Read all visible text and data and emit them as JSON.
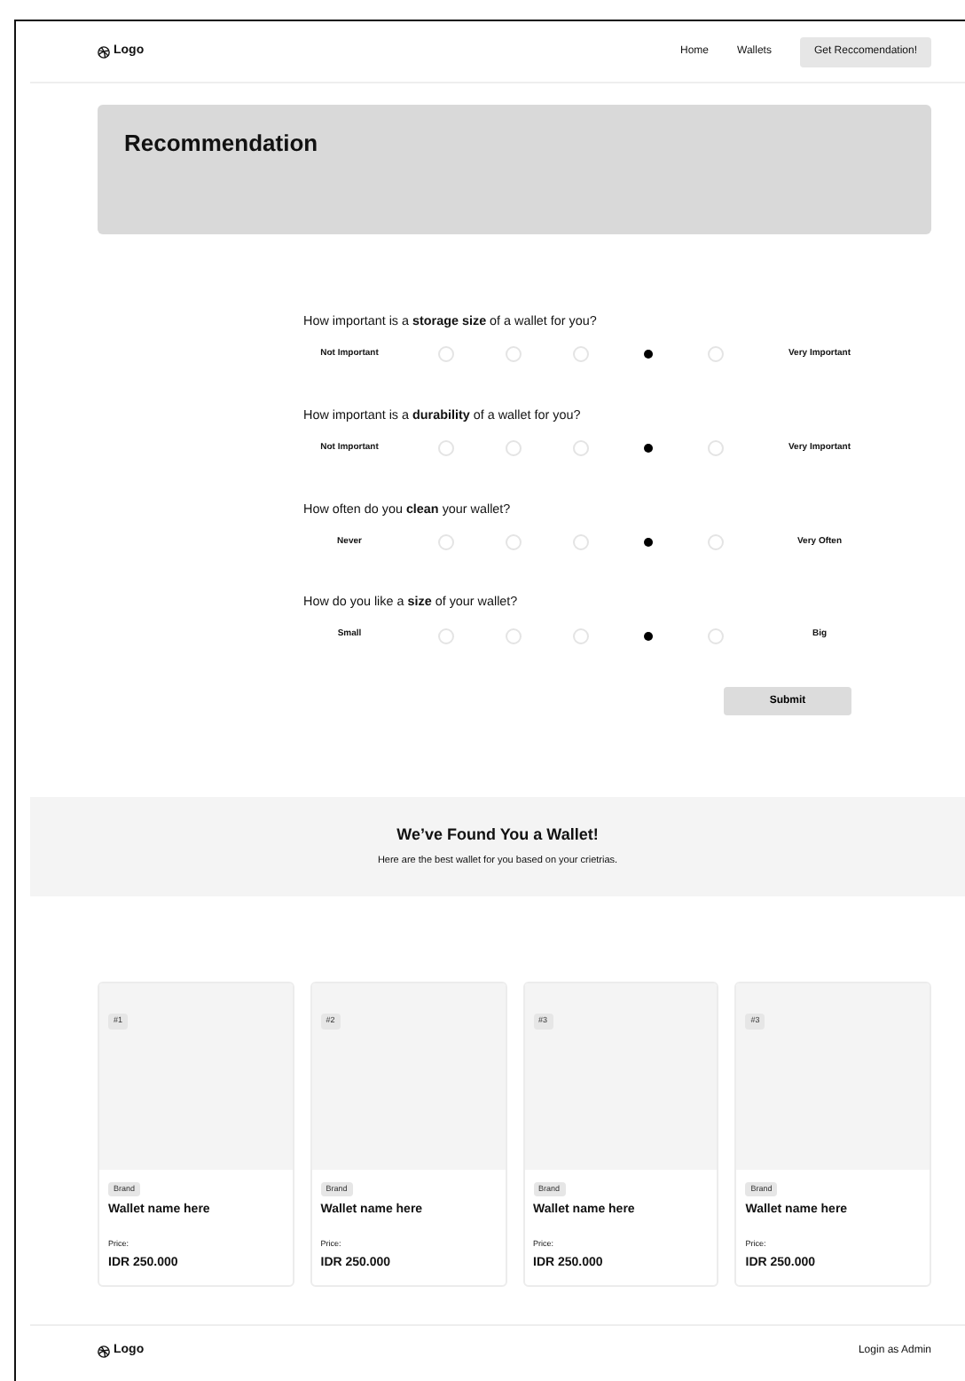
{
  "nav": {
    "logo": "Logo",
    "links": [
      "Home",
      "Wallets"
    ],
    "cta": "Get Reccomendation!"
  },
  "hero": {
    "title": "Recommendation"
  },
  "questions": [
    {
      "text": "How important is a **storage size** of a wallet for you?",
      "low": "Not Important",
      "high": "Very Important",
      "options": [
        {
          "selected": false
        },
        {
          "selected": false
        },
        {
          "selected": false
        },
        {
          "selected": true
        },
        {
          "selected": false
        }
      ]
    },
    {
      "text": "How important is a **durability** of a wallet for you?",
      "low": "Not Important",
      "high": "Very Important",
      "options": [
        {
          "selected": false
        },
        {
          "selected": false
        },
        {
          "selected": false
        },
        {
          "selected": true
        },
        {
          "selected": false
        }
      ]
    },
    {
      "text": "How often do you **clean** your wallet?",
      "low": "Never",
      "high": "Very Often",
      "options": [
        {
          "selected": false
        },
        {
          "selected": false
        },
        {
          "selected": false
        },
        {
          "selected": true
        },
        {
          "selected": false
        }
      ]
    },
    {
      "text": "How do you like a **size** of your wallet?",
      "low": "Small",
      "high": "Big",
      "options": [
        {
          "selected": false
        },
        {
          "selected": false
        },
        {
          "selected": false
        },
        {
          "selected": true
        },
        {
          "selected": false
        }
      ]
    }
  ],
  "submit": "Submit",
  "result": {
    "title": "We’ve Found You a Wallet!",
    "subtitle": "Here are the best wallet for you based on your crietrias."
  },
  "wallets": [
    {
      "rank": "#1",
      "brand": "Brand",
      "name": "Wallet name here",
      "price_label": "Price:",
      "price": "IDR 250.000"
    },
    {
      "rank": "#2",
      "brand": "Brand",
      "name": "Wallet name here",
      "price_label": "Price:",
      "price": "IDR 250.000"
    },
    {
      "rank": "#3",
      "brand": "Brand",
      "name": "Wallet name here",
      "price_label": "Price:",
      "price": "IDR 250.000"
    },
    {
      "rank": "#3",
      "brand": "Brand",
      "name": "Wallet name here",
      "price_label": "Price:",
      "price": "IDR 250.000"
    }
  ],
  "footer": {
    "logo": "Logo",
    "link": "Login as Admin"
  }
}
